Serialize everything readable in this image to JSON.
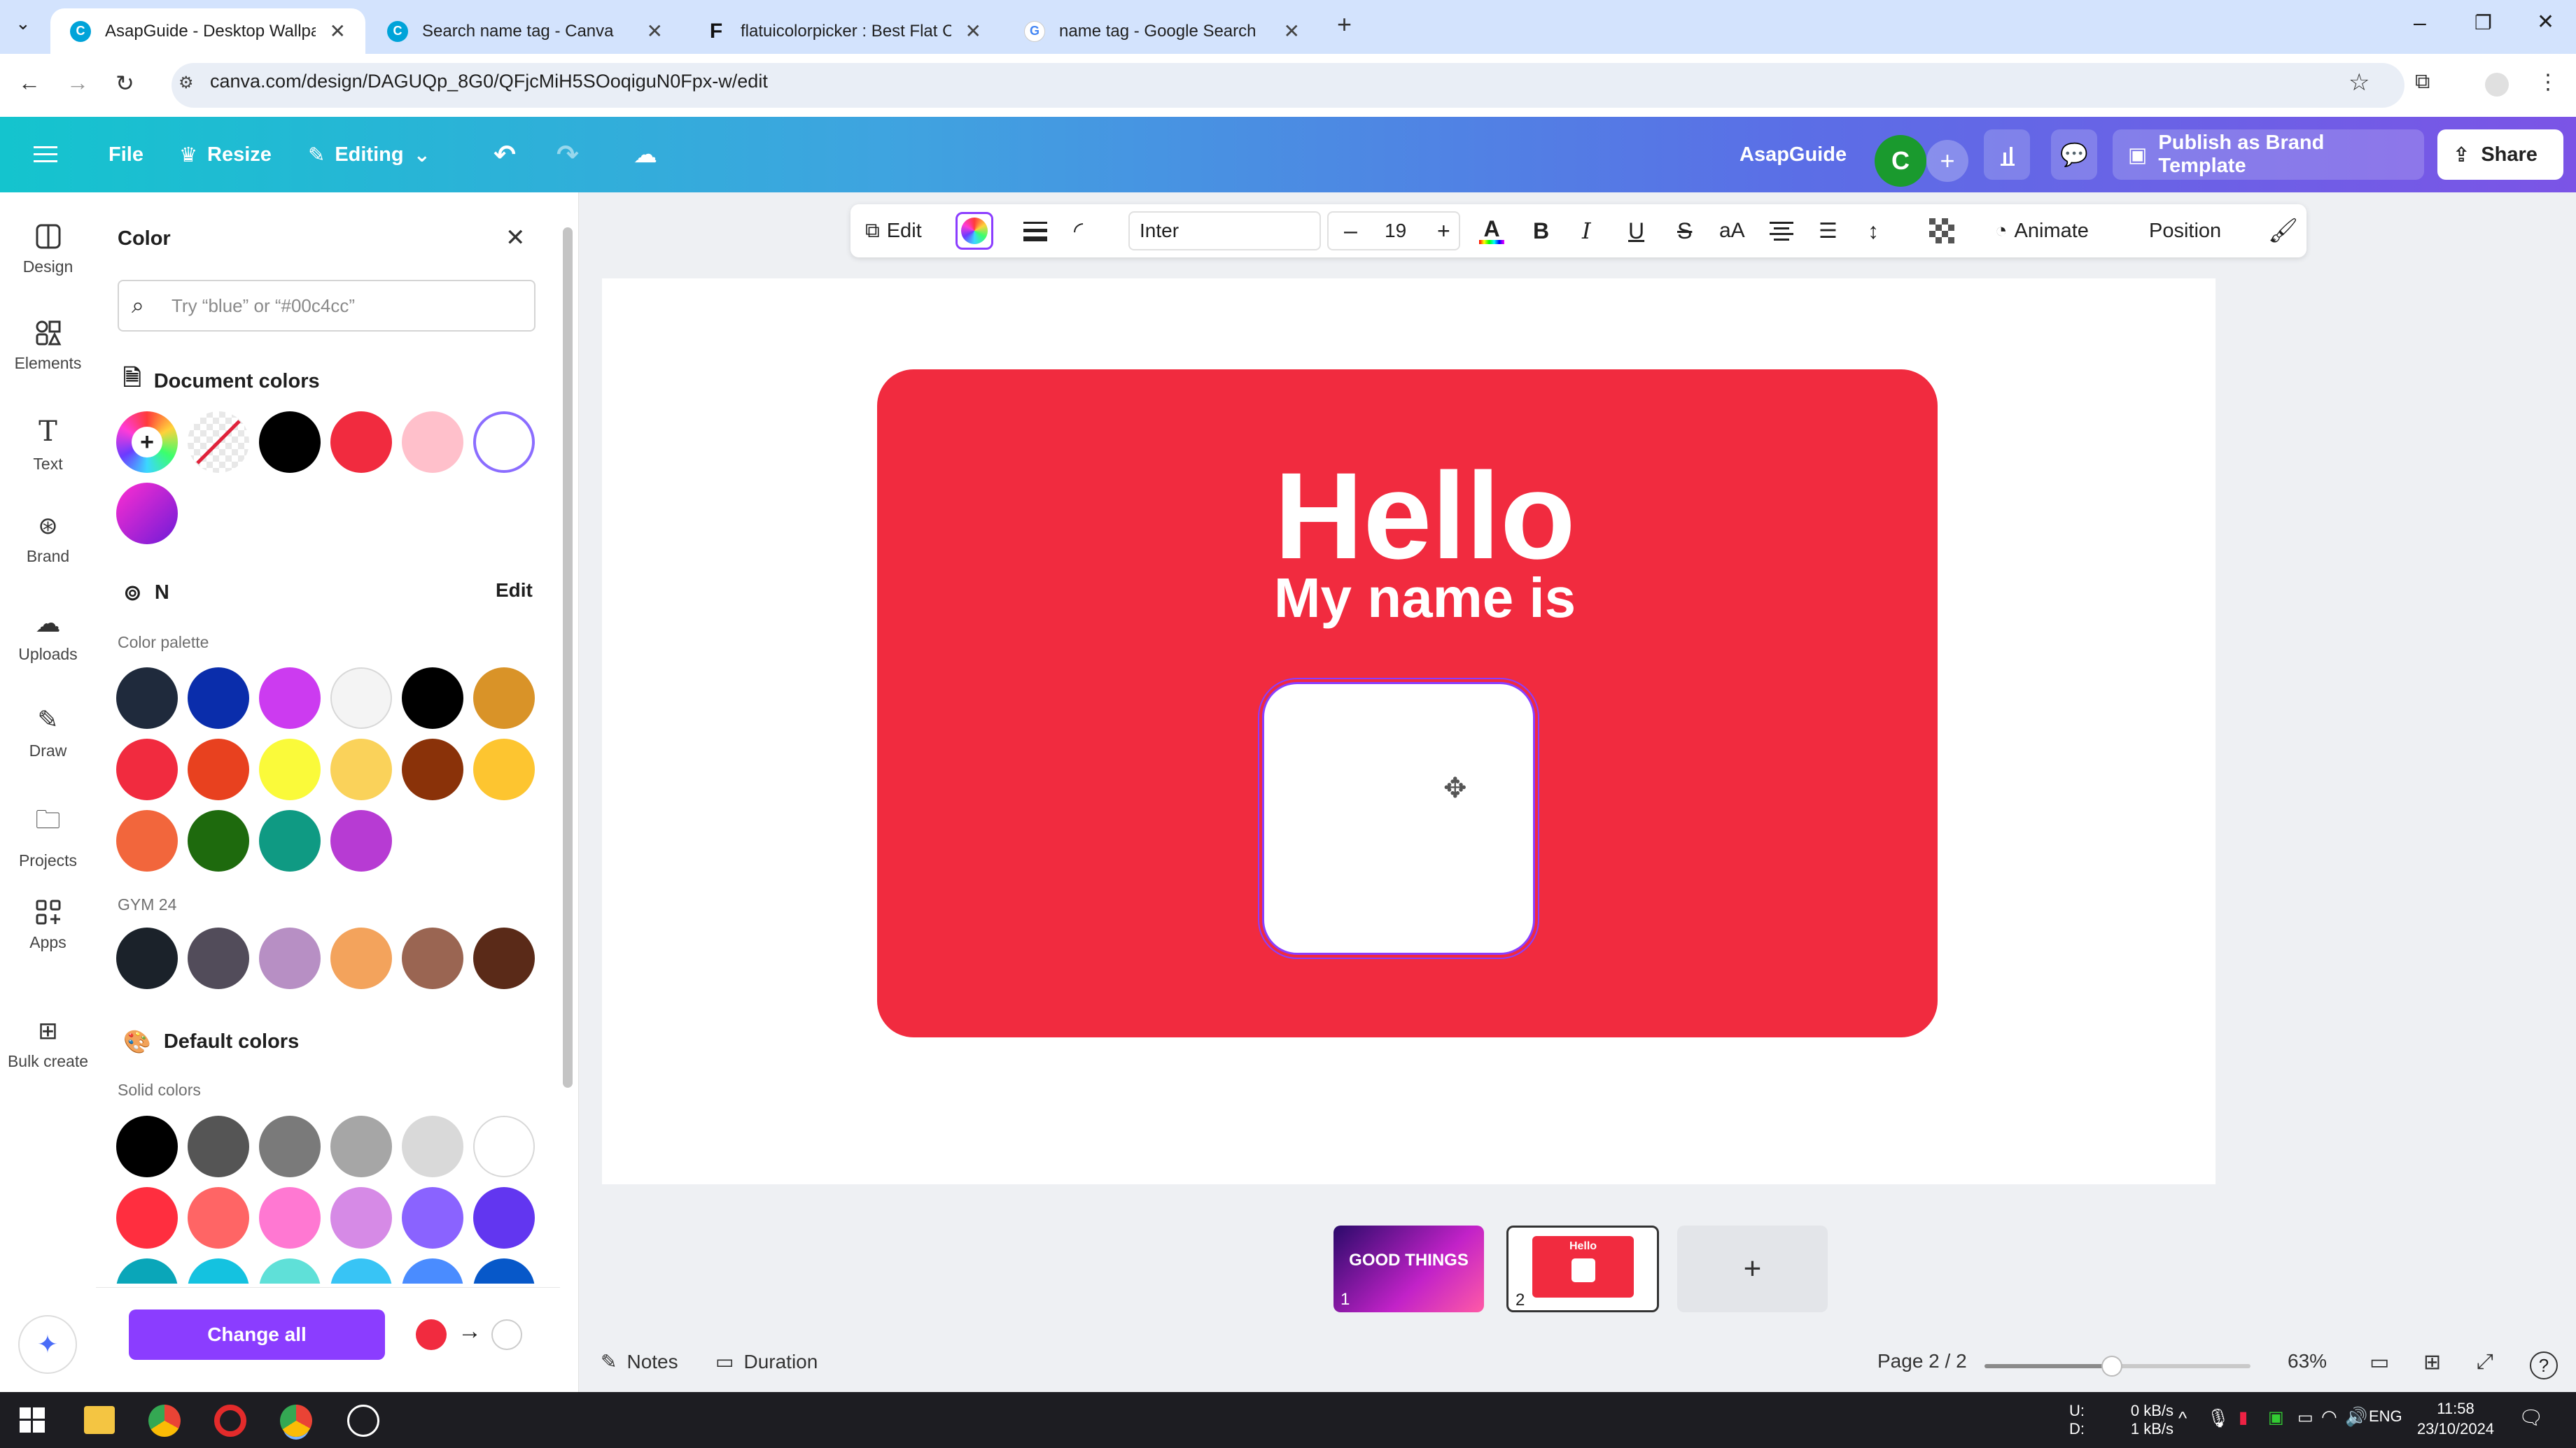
{
  "browser": {
    "tabs": [
      {
        "title": "AsapGuide - Desktop Wallpaper",
        "active": true
      },
      {
        "title": "Search name tag - Canva",
        "active": false
      },
      {
        "title": "flatuicolorpicker : Best Flat Colo",
        "active": false
      },
      {
        "title": "name tag - Google Search",
        "active": false
      }
    ],
    "url": "canva.com/design/DAGUQp_8G0/QFjcMiH5SOoqiguN0Fpx-w/edit"
  },
  "canva_header": {
    "file": "File",
    "resize": "Resize",
    "editing": "Editing",
    "team_name": "AsapGuide",
    "avatar_letter": "C",
    "publish": "Publish as Brand Template",
    "share": "Share"
  },
  "rail": [
    {
      "label": "Design",
      "icon": "design-icon"
    },
    {
      "label": "Elements",
      "icon": "elements-icon"
    },
    {
      "label": "Text",
      "icon": "text-icon"
    },
    {
      "label": "Brand",
      "icon": "brand-icon"
    },
    {
      "label": "Uploads",
      "icon": "uploads-icon"
    },
    {
      "label": "Draw",
      "icon": "draw-icon"
    },
    {
      "label": "Projects",
      "icon": "projects-icon"
    },
    {
      "label": "Apps",
      "icon": "apps-icon"
    },
    {
      "label": "Bulk create",
      "icon": "bulk-create-icon"
    }
  ],
  "color_panel": {
    "title": "Color",
    "search_placeholder": "Try “blue” or “#00c4cc”",
    "document_colors_title": "Document colors",
    "document_colors": [
      "#000000",
      "#f12b3f",
      "#ffc0cb",
      "#ffffff"
    ],
    "brand_kit_name": "N",
    "edit": "Edit",
    "palette_label": "Color palette",
    "palette": [
      "#1f2a3c",
      "#0a2dab",
      "#cc3bf0",
      "#f4f4f4",
      "#000000",
      "#d99328",
      "#f12b3f",
      "#e8411f",
      "#fafa3a",
      "#fad25a",
      "#8a3209",
      "#fdc530",
      "#f2663c",
      "#1e6a0d",
      "#0f9a83",
      "#b73bd3"
    ],
    "gym_label": "GYM 24",
    "gym": [
      "#1b222a",
      "#524c5a",
      "#b78fc4",
      "#f3a35c",
      "#9a6552",
      "#5a2a18"
    ],
    "default_title": "Default colors",
    "solid_label": "Solid colors",
    "solid": [
      "#000000",
      "#555555",
      "#7a7a7a",
      "#a6a6a6",
      "#d9d9d9",
      "#ffffff",
      "#ff2e3f",
      "#ff6565",
      "#ff78d2",
      "#d68ae6",
      "#8a63ff",
      "#6236f0",
      "#0aa6b9",
      "#14c2e0",
      "#5fe0d8",
      "#38c4f5",
      "#4a8cff",
      "#0758c9"
    ],
    "change_all": "Change all",
    "from_color": "#f12b3f",
    "to_color": "#ffffff"
  },
  "toolbar": {
    "edit": "Edit",
    "font": "Inter",
    "font_size": "19",
    "animate": "Animate",
    "position": "Position"
  },
  "design": {
    "hello": "Hello",
    "my_name_is": "My name is",
    "tag_color": "#f12b3f"
  },
  "pages": {
    "thumb1_text": "GOOD THINGS",
    "thumb1_num": "1",
    "thumb2_text": "Hello",
    "thumb2_num": "2"
  },
  "bottom": {
    "notes": "Notes",
    "duration": "Duration",
    "page_indicator": "Page 2 / 2",
    "zoom": "63%",
    "zoom_fraction": 0.48
  },
  "taskbar": {
    "net_up": "0 kB/s",
    "net_down": "1 kB/s",
    "u_label": "U:",
    "d_label": "D:",
    "lang": "ENG",
    "time": "11:58",
    "date": "23/10/2024"
  }
}
